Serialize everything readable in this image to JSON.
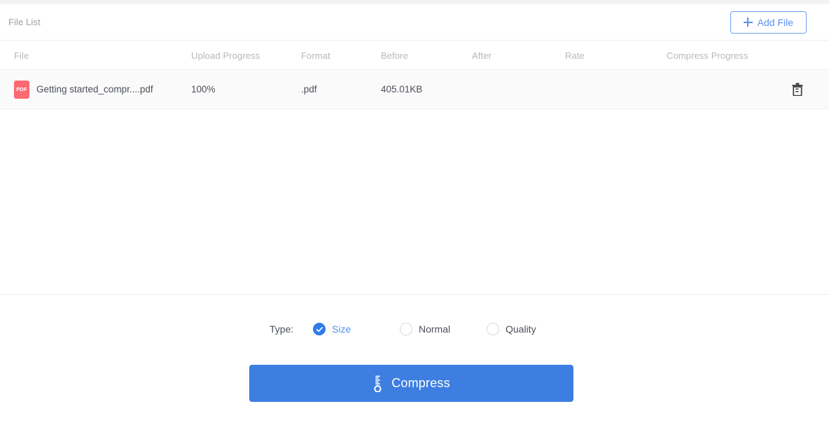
{
  "panel": {
    "title": "File List",
    "add_file_label": "Add File",
    "add_file_icon": "plus-icon"
  },
  "table": {
    "columns": [
      "File",
      "Upload Progress",
      "Format",
      "Before",
      "After",
      "Rate",
      "Compress Progress"
    ],
    "rows": [
      {
        "file_type_badge": "PDF",
        "file_name": "Getting started_compr....pdf",
        "upload_progress": "100%",
        "format": ".pdf",
        "before": "405.01KB",
        "after": "",
        "rate": "",
        "compress_progress": "",
        "action_icon": "trash-icon"
      }
    ]
  },
  "controls": {
    "type_label": "Type:",
    "options": [
      {
        "label": "Size",
        "selected": true
      },
      {
        "label": "Normal",
        "selected": false
      },
      {
        "label": "Quality",
        "selected": false
      }
    ],
    "compress_label": "Compress",
    "compress_icon": "compress-icon"
  },
  "colors": {
    "accent_blue": "#3d7ee0",
    "link_blue": "#5b8ff0",
    "pdf_red": "#fa6a73",
    "row_bg": "#fafafb",
    "muted_text": "#b4b8c0"
  }
}
